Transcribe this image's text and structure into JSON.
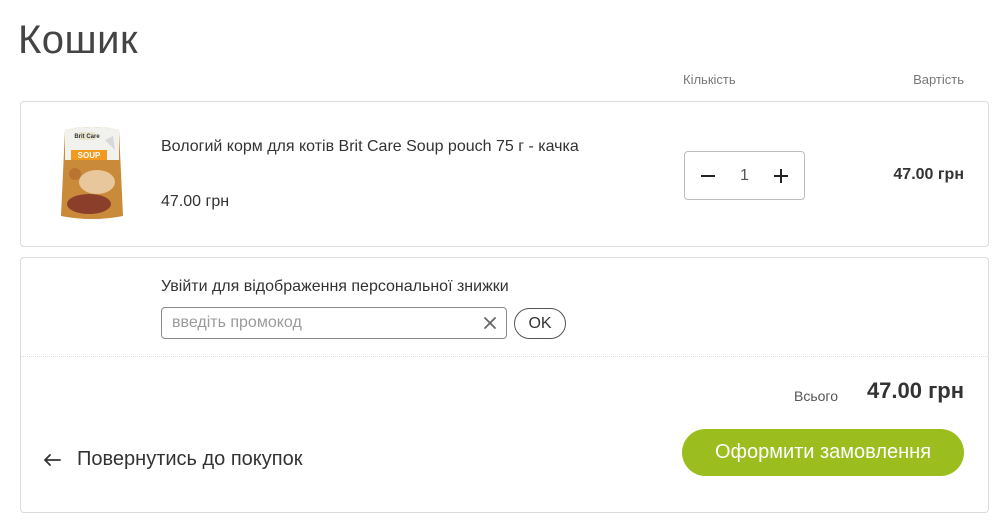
{
  "page": {
    "title": "Кошик"
  },
  "columns": {
    "quantity": "Кількість",
    "cost": "Вартість"
  },
  "item": {
    "name": "Вологий корм для котів Brit Care Soup pouch 75 г - качка",
    "price": "47.00 грн",
    "quantity": "1",
    "line_total": "47.00 грн",
    "image_icon": "product-pouch-image",
    "image_label": "SOUP",
    "image_brand": "Brit Care"
  },
  "summary": {
    "discount_link": "Увійти для відображення персональної знижки",
    "promo": {
      "placeholder": "введіть промокод",
      "value": ""
    },
    "ok_label": "OK",
    "total_label": "Всього",
    "total_value": "47.00 грн",
    "back_label": "Повернутись до покупок",
    "checkout_label": "Оформити замовлення"
  },
  "colors": {
    "accent": "#9bbd1e",
    "border": "#dcdcdc",
    "text": "#333333"
  }
}
